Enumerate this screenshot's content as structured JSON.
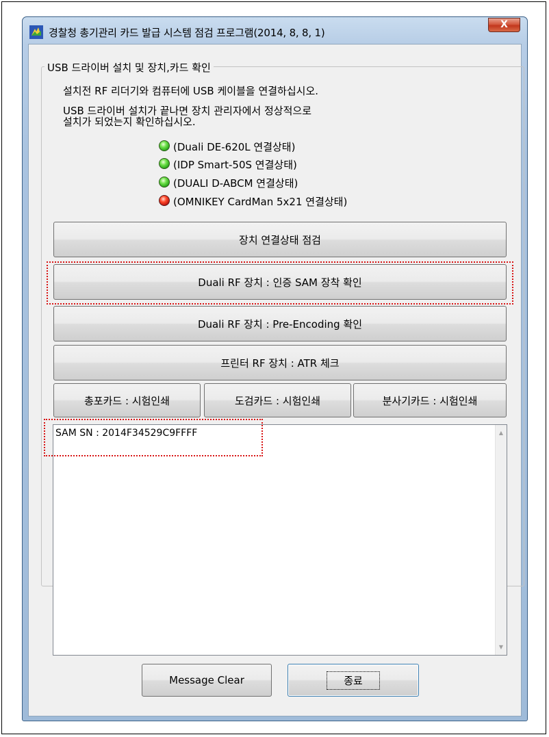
{
  "window": {
    "title": "경찰청 총기관리 카드 발급 시스템 점검 프로그램(2014, 8, 8, 1)",
    "close_label": "X"
  },
  "group": {
    "legend": "USB 드라이버 설치 및 장치,카드 확인",
    "instruction_1": "설치전 RF 리더기와 컴퓨터에 USB 케이블을 연결하십시오.",
    "instruction_2a": "USB 드라이버 설치가 끝나면 장치 관리자에서 정상적으로",
    "instruction_2b": "설치가 되었는지 확인하십시오."
  },
  "devices": [
    {
      "label": "(Duali DE-620L 연결상태)",
      "status": "green"
    },
    {
      "label": "(IDP Smart-50S 연결상태)",
      "status": "green"
    },
    {
      "label": "(DUALI D-ABCM 연결상태)",
      "status": "green"
    },
    {
      "label": "(OMNIKEY CardMan 5x21 연결상태)",
      "status": "red"
    }
  ],
  "buttons": {
    "check_connection": "장치 연결상태 점검",
    "sam_check": "Duali RF 장치 : 인증 SAM 장착 확인",
    "pre_encoding": "Duali RF 장치 : Pre-Encoding 확인",
    "atr_check": "프린터 RF 장치 : ATR 체크",
    "gun_card": "총포카드 : 시험인쇄",
    "sword_card": "도검카드 : 시험인쇄",
    "sprayer_card": "분사기카드 : 시험인쇄",
    "message_clear": "Message Clear",
    "exit": "종료"
  },
  "log": {
    "line_1": "SAM SN : 2014F34529C9FFFF"
  },
  "colors": {
    "led_green": "#1e9d12",
    "led_red": "#b40d0d",
    "highlight": "#d81313"
  }
}
